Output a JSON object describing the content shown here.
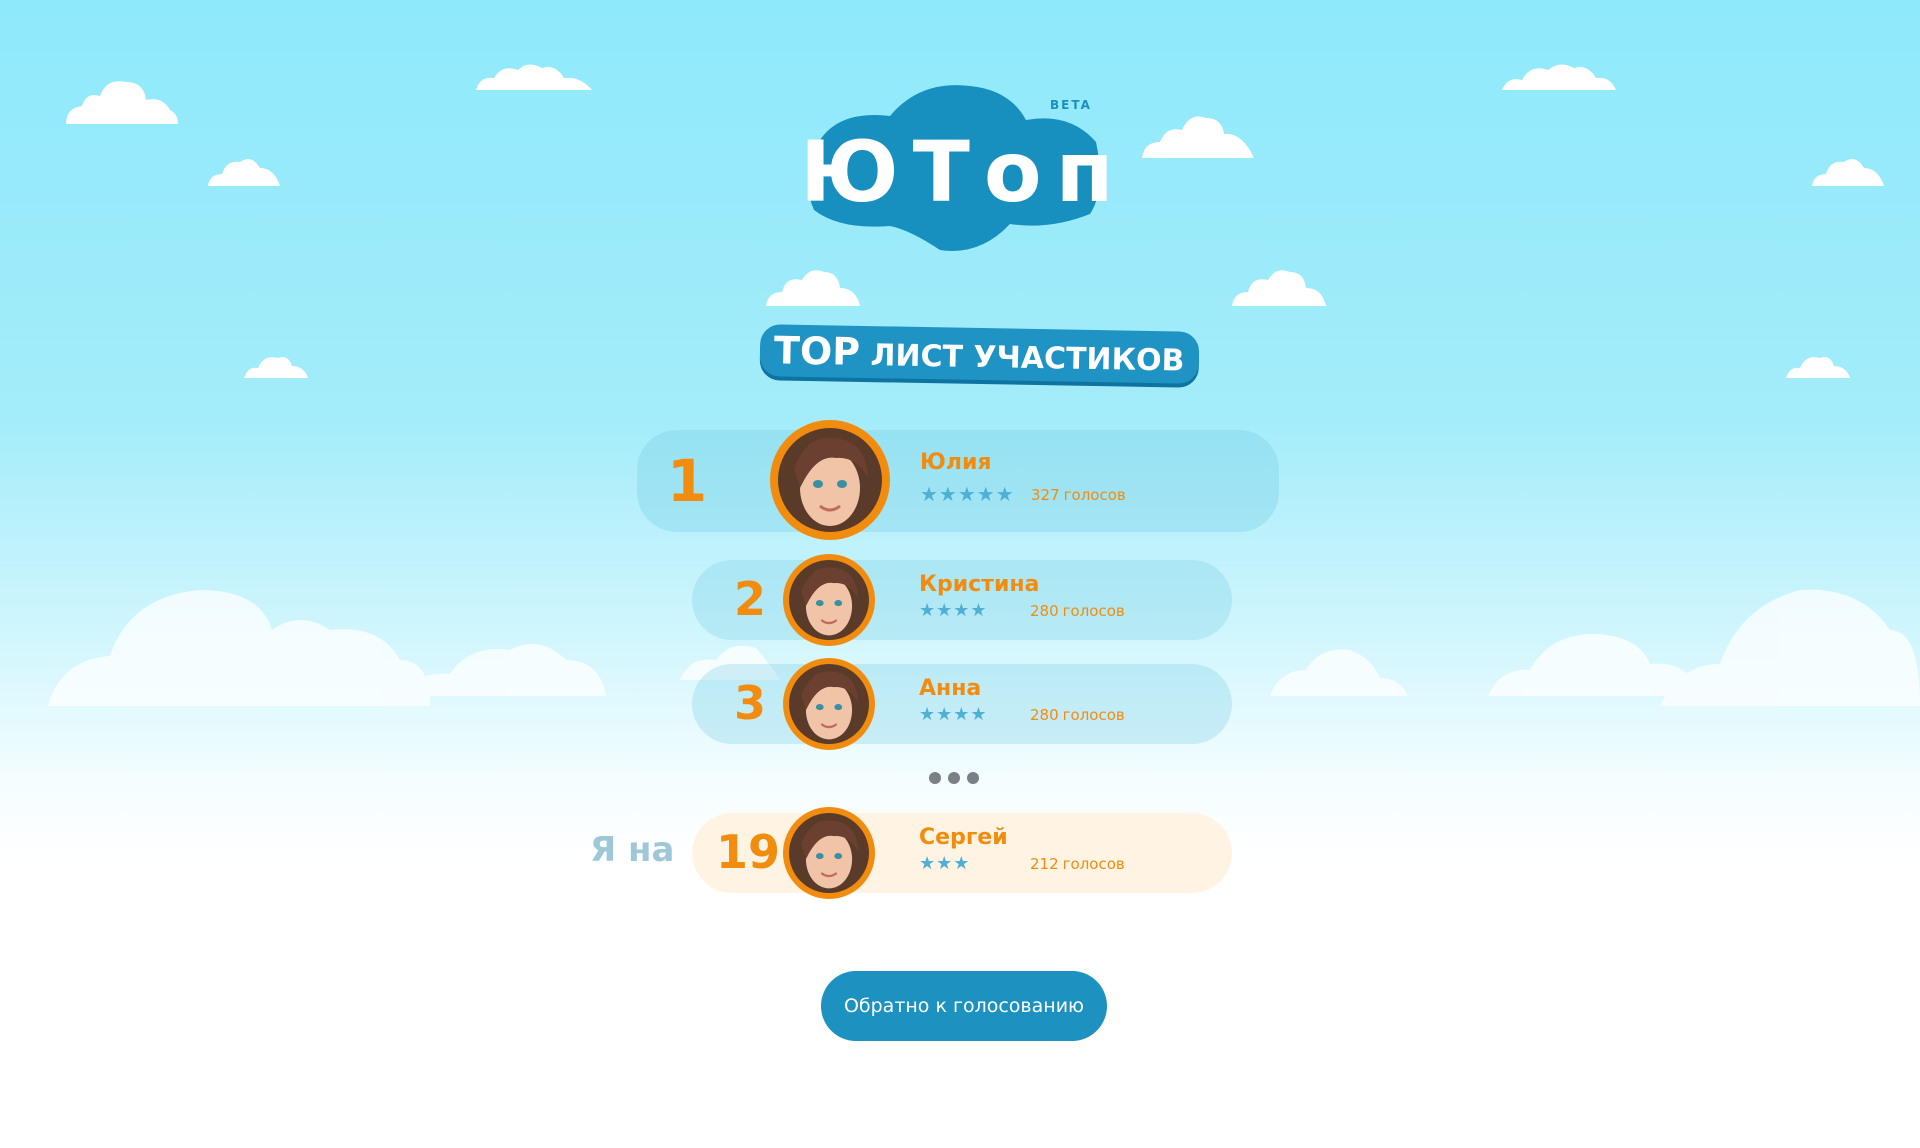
{
  "brand": {
    "logo_text": "ЮТоп",
    "beta": "BETA"
  },
  "heading": {
    "top": "TOP",
    "rest": "лист участиков"
  },
  "participants": [
    {
      "rank": "1",
      "name": "Юлия",
      "rating": 5,
      "stars": "★★★★★",
      "votes": "327",
      "votes_label": "голосов"
    },
    {
      "rank": "2",
      "name": "Кристина",
      "rating": 4,
      "stars": "★★★★",
      "votes": "280",
      "votes_label": "голосов"
    },
    {
      "rank": "3",
      "name": "Анна",
      "rating": 4,
      "stars": "★★★★",
      "votes": "280",
      "votes_label": "голосов"
    }
  ],
  "me": {
    "label": "Я на",
    "rank": "19",
    "name": "Сергей",
    "rating": 3,
    "stars": "★★★",
    "votes": "212",
    "votes_label": "голосов"
  },
  "actions": {
    "back_label": "Обратно к голосованию"
  },
  "colors": {
    "accent": "#f28c0f",
    "primary": "#1d91c0",
    "star": "#4fb0d6",
    "sky": "#8ee9fb"
  },
  "icons": {
    "rating": "star-icon",
    "more": "ellipsis-icon",
    "avatar": "user-photo"
  }
}
